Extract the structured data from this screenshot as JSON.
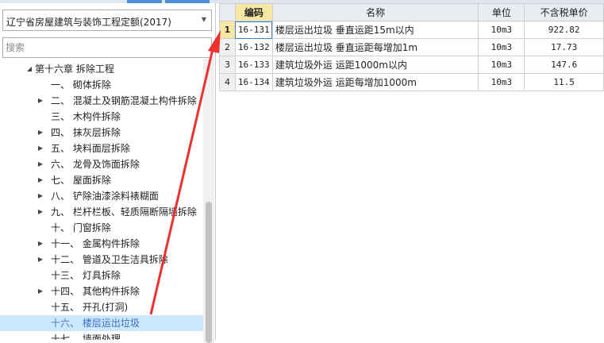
{
  "colors": {
    "arrow": "#f03030",
    "selected_row": "#cce8ff",
    "header_active": "#f6e7a3"
  },
  "quota_select": {
    "value": "辽宁省房屋建筑与装饰工程定额(2017)",
    "icon": "chevron-down-icon"
  },
  "search": {
    "placeholder": "搜索"
  },
  "tree": {
    "items": [
      {
        "label": "第十六章  拆除工程",
        "expander": "expanded",
        "selected": false
      },
      {
        "label": "一、  砌体拆除",
        "expander": "none",
        "selected": false
      },
      {
        "label": "二、  混凝土及钢筋混凝土构件拆除",
        "expander": "collapsed",
        "selected": false
      },
      {
        "label": "三、  木构件拆除",
        "expander": "none",
        "selected": false
      },
      {
        "label": "四、  抹灰层拆除",
        "expander": "collapsed",
        "selected": false
      },
      {
        "label": "五、  块料面层拆除",
        "expander": "collapsed",
        "selected": false
      },
      {
        "label": "六、  龙骨及饰面拆除",
        "expander": "collapsed",
        "selected": false
      },
      {
        "label": "七、  屋面拆除",
        "expander": "collapsed",
        "selected": false
      },
      {
        "label": "八、  铲除油漆涂料裱糊面",
        "expander": "collapsed",
        "selected": false
      },
      {
        "label": "九、  栏杆栏板、轻质隔断隔墙拆除",
        "expander": "collapsed",
        "selected": false
      },
      {
        "label": "十、  门窗拆除",
        "expander": "none",
        "selected": false
      },
      {
        "label": "十一、  金属构件拆除",
        "expander": "collapsed",
        "selected": false
      },
      {
        "label": "十二、  管道及卫生洁具拆除",
        "expander": "collapsed",
        "selected": false
      },
      {
        "label": "十三、  灯具拆除",
        "expander": "none",
        "selected": false
      },
      {
        "label": "十四、  其他构件拆除",
        "expander": "collapsed",
        "selected": false
      },
      {
        "label": "十五、  开孔(打洞)",
        "expander": "none",
        "selected": false
      },
      {
        "label": "十六、  楼层运出垃圾",
        "expander": "none",
        "selected": true
      },
      {
        "label": "十七、  墙面处理",
        "expander": "none",
        "selected": false
      }
    ]
  },
  "grid": {
    "headers": {
      "code": "编码",
      "name": "名称",
      "unit": "单位",
      "price": "不含税单价"
    },
    "rows": [
      {
        "num": "1",
        "code": "16-131",
        "name": "楼层运出垃圾  垂直运距15m以内",
        "unit": "10m3",
        "price": "922.82"
      },
      {
        "num": "2",
        "code": "16-132",
        "name": "楼层运出垃圾  垂直运距每增加1m",
        "unit": "10m3",
        "price": "17.73"
      },
      {
        "num": "3",
        "code": "16-133",
        "name": "建筑垃圾外运  运距1000m以内",
        "unit": "10m3",
        "price": "147.6"
      },
      {
        "num": "4",
        "code": "16-134",
        "name": "建筑垃圾外运  运距每增加1000m",
        "unit": "10m3",
        "price": "11.5"
      }
    ]
  }
}
